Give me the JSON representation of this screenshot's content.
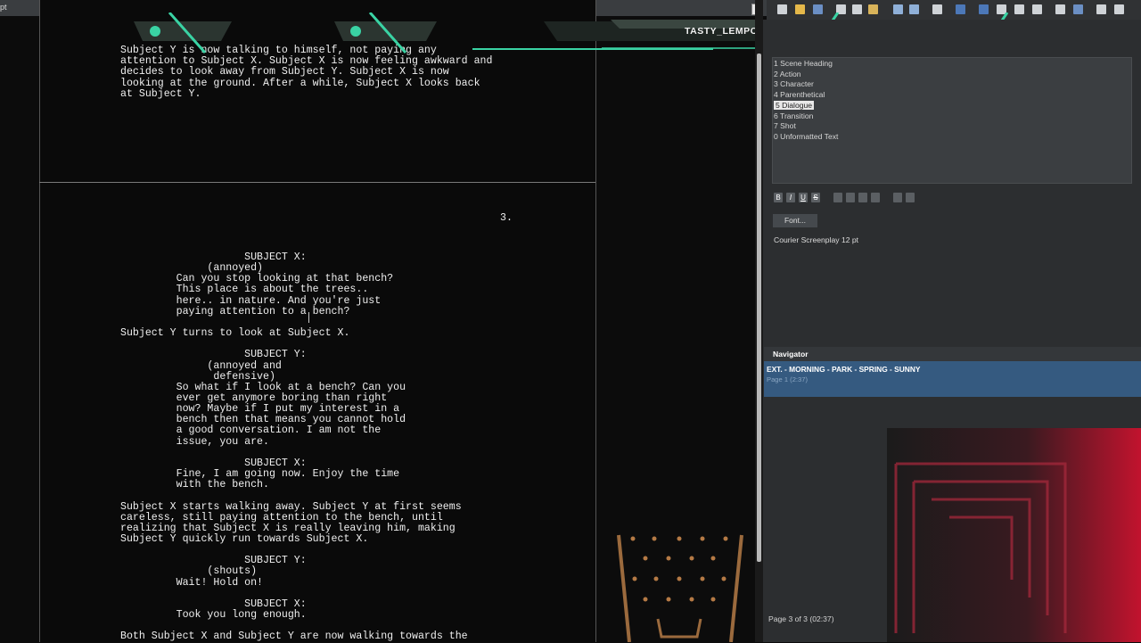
{
  "titlebar": {
    "tab_fragment": "pt"
  },
  "overlay": {
    "streamer_name": "TASTY_LEMPONS"
  },
  "script": {
    "page_number": "3.",
    "page2_lines": [
      "Subject Y is now talking to himself, not paying any",
      "attention to Subject X. Subject X is now feeling awkward and",
      "decides to look away from Subject Y. Subject X is now",
      "looking at the ground. After a while, Subject X looks back",
      "at Subject Y."
    ],
    "page3_lines": [
      "                    SUBJECT X:",
      "              (annoyed)",
      "         Can you stop looking at that bench?",
      "         This place is about the trees..",
      "         here.. in nature. And you're just",
      "         paying attention to a bench?",
      "",
      "Subject Y turns to look at Subject X.",
      "",
      "                    SUBJECT Y:",
      "              (annoyed and",
      "               defensive)",
      "         So what if I look at a bench? Can you",
      "         ever get anymore boring than right",
      "         now? Maybe if I put my interest in a",
      "         bench then that means you cannot hold",
      "         a good conversation. I am not the",
      "         issue, you are.",
      "",
      "                    SUBJECT X:",
      "         Fine, I am going now. Enjoy the time",
      "         with the bench.",
      "",
      "Subject X starts walking away. Subject Y at first seems",
      "careless, still paying attention to the bench, until",
      "realizing that Subject X is really leaving him, making",
      "Subject Y quickly run towards Subject X.",
      "",
      "                    SUBJECT Y:",
      "              (shouts)",
      "         Wait! Hold on!",
      "",
      "                    SUBJECT X:",
      "         Took you long enough.",
      "",
      "Both Subject X and Subject Y are now walking towards the"
    ]
  },
  "elements_panel": {
    "items": [
      {
        "label": "1 Scene Heading",
        "selected": false
      },
      {
        "label": "2 Action",
        "selected": false
      },
      {
        "label": "3 Character",
        "selected": false
      },
      {
        "label": "4 Parenthetical",
        "selected": false
      },
      {
        "label": "5 Dialogue",
        "selected": true
      },
      {
        "label": "6 Transition",
        "selected": false
      },
      {
        "label": "7 Shot",
        "selected": false
      },
      {
        "label": "0 Unformatted Text",
        "selected": false
      }
    ],
    "format_buttons": [
      "B",
      "I",
      "U",
      "S"
    ],
    "font_button": "Font...",
    "font_desc": "Courier Screenplay 12 pt"
  },
  "navigator": {
    "header": "Navigator",
    "scene_title": "EXT. - MORNING - PARK - SPRING - SUNNY",
    "scene_sub": "Page 1 (2:37)",
    "page_info": "Page 3 of 3 (02:37)"
  },
  "colors": {
    "accent": "#3ad3a4",
    "selection": "#355a80",
    "webcam_red": "#c2132e"
  }
}
